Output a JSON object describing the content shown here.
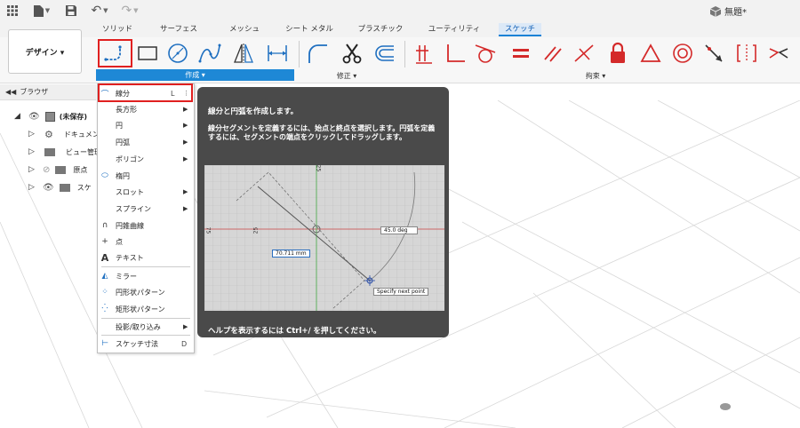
{
  "quick_access": {
    "doc_title": "無題*"
  },
  "tabs": [
    {
      "label": "ソリッド",
      "active": false
    },
    {
      "label": "サーフェス",
      "active": false
    },
    {
      "label": "メッシュ",
      "active": false
    },
    {
      "label": "シート メタル",
      "active": false
    },
    {
      "label": "プラスチック",
      "active": false
    },
    {
      "label": "ユーティリティ",
      "active": false
    },
    {
      "label": "スケッチ",
      "active": true
    }
  ],
  "workspace_button": {
    "label": "デザイン ▾"
  },
  "ribbon": {
    "groups": {
      "create": "作成 ▾",
      "modify": "修正 ▾",
      "constraints": "拘束 ▾"
    }
  },
  "browser": {
    "title": "ブラウザ",
    "items": [
      {
        "label": "(未保存)"
      },
      {
        "label": "ドキュメン"
      },
      {
        "label": "ビュー管理"
      },
      {
        "label": "原点"
      },
      {
        "label": "スケ"
      }
    ]
  },
  "create_menu": {
    "items": [
      {
        "label": "線分",
        "key": "L",
        "submenu": false,
        "highlighted": true
      },
      {
        "label": "長方形",
        "submenu": true
      },
      {
        "label": "円",
        "submenu": true
      },
      {
        "label": "円弧",
        "submenu": true
      },
      {
        "label": "ポリゴン",
        "submenu": true
      },
      {
        "label": "楕円",
        "submenu": false
      },
      {
        "label": "スロット",
        "submenu": true
      },
      {
        "label": "スプライン",
        "submenu": true
      },
      {
        "label": "円錐曲線",
        "submenu": false
      },
      {
        "label": "点",
        "submenu": false
      },
      {
        "label": "テキスト",
        "submenu": false
      },
      {
        "label": "ミラー",
        "submenu": false
      },
      {
        "label": "円形状パターン",
        "submenu": false
      },
      {
        "label": "矩形状パターン",
        "submenu": false
      },
      {
        "label": "投影/取り込み",
        "submenu": true
      },
      {
        "label": "スケッチ寸法",
        "key": "D",
        "submenu": false
      }
    ]
  },
  "tooltip": {
    "title": "線分と円弧を作成します。",
    "body": "線分セグメントを定義するには、始点と終点を選択します。円弧を定義するには、セグメントの端点をクリックしてドラッグします。",
    "footer": "ヘルプを表示するには Ctrl+/ を押してください。",
    "image_labels": {
      "dim_top": "25",
      "dim_side": "25",
      "dim_left": "75",
      "angle": "45.0 deg",
      "length": "70.711 mm",
      "prompt": "Specify next point"
    }
  },
  "colors": {
    "accent": "#1e88d6",
    "highlight": "#e02020",
    "constraint_red": "#d42a2a",
    "tooltip_bg": "#4a4a4a"
  }
}
